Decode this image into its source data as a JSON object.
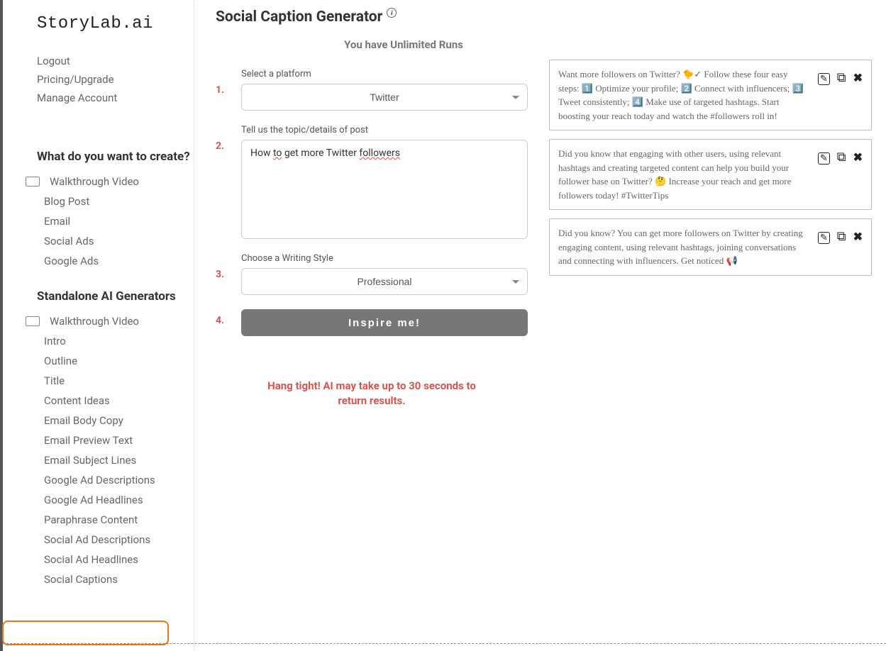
{
  "logo": "StoryLab.ai",
  "account_links": [
    "Logout",
    "Pricing/Upgrade",
    "Manage Account"
  ],
  "sidebar": {
    "section1_title": "What do you want to create?",
    "section1_items": [
      "Walkthrough Video",
      "Blog Post",
      "Email",
      "Social Ads",
      "Google Ads"
    ],
    "section2_title": "Standalone AI Generators",
    "section2_items": [
      "Walkthrough Video",
      "Intro",
      "Outline",
      "Title",
      "Content Ideas",
      "Email Body Copy",
      "Email Preview Text",
      "Email Subject Lines",
      "Google Ad Descriptions",
      "Google Ad Headlines",
      "Paraphrase Content",
      "Social Ad Descriptions",
      "Social Ad Headlines",
      "Social Captions"
    ]
  },
  "page_title": "Social Caption Generator",
  "runs_message": "You have Unlimited Runs",
  "steps": {
    "s1_num": "1.",
    "s1_label": "Select a platform",
    "s1_value": "Twitter",
    "s2_num": "2.",
    "s2_label": "Tell us the topic/details of post",
    "s2_value_pre": "How ",
    "s2_value_sq1": "to",
    "s2_value_mid": " get more Twitter ",
    "s2_value_sq2": "followers",
    "s3_num": "3.",
    "s3_label": "Choose a Writing Style",
    "s3_value": "Professional",
    "s4_num": "4.",
    "s4_button": "Inspire me!"
  },
  "wait_message": "Hang tight! AI may take up to 30 seconds to return results.",
  "results": [
    "Want more followers on Twitter? 🐤✓ Follow these four easy steps: 1️⃣ Optimize your profile; 2️⃣ Connect with influencers; 3️⃣ Tweet consistently; 4️⃣ Make use of targeted hashtags. Start boosting your reach today and watch the #followers roll in!",
    "Did you know that engaging with other users, using relevant hashtags and creating targeted content can help you build your follower base on Twitter? 🤔 Increase your reach and get more followers today! #TwitterTips",
    "Did you know? You can get more followers on Twitter by creating engaging content, using relevant hashtags, joining conversations and connecting with influencers. Get noticed 📢"
  ]
}
